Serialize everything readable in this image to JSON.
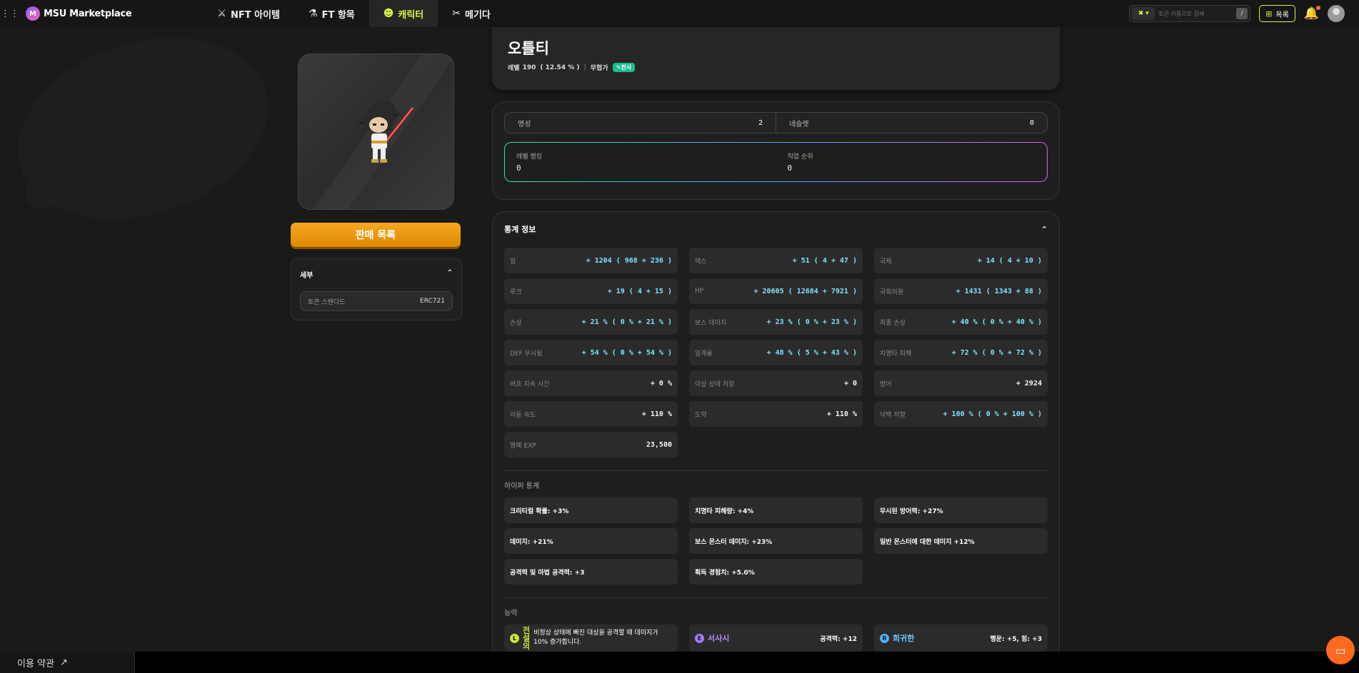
{
  "header": {
    "logo_text": "MSU Marketplace",
    "nav": [
      {
        "label": "NFT 아이템",
        "icon": "swords-icon"
      },
      {
        "label": "FT 항목",
        "icon": "potion-icon"
      },
      {
        "label": "캐릭터",
        "icon": "character-icon",
        "active": true
      },
      {
        "label": "메기다",
        "icon": "tools-icon"
      }
    ],
    "search_placeholder": "토큰 이름으로 검색",
    "search_shortcut": "/",
    "list_button": "목록"
  },
  "footer": {
    "terms": "이용 약관"
  },
  "left": {
    "sell_button": "판매 목록",
    "detail_title": "세부",
    "detail_rows": [
      {
        "key": "토큰 스탠다드",
        "value": "ERC721"
      }
    ]
  },
  "character": {
    "name": "오틀티",
    "level_label": "레벨",
    "level": "190",
    "level_pct": "( 12.54 % )",
    "job": "무협가",
    "job_badge": "전사"
  },
  "fame": [
    {
      "key": "명성",
      "value": "2"
    },
    {
      "key": "네슬렛",
      "value": "0"
    }
  ],
  "ranking": [
    {
      "key": "레벨 랭킹",
      "value": "0"
    },
    {
      "key": "직업 순위",
      "value": "0"
    }
  ],
  "stats": {
    "title": "통계 정보",
    "items": [
      {
        "key": "힘",
        "value": "+ 1204 ( 968 + 236 )",
        "accent": true
      },
      {
        "key": "덱스",
        "value": "+ 51 ( 4 + 47 )",
        "accent": true
      },
      {
        "key": "국제",
        "value": "+ 14 ( 4 + 10 )",
        "accent": true
      },
      {
        "key": "루크",
        "value": "+ 19 ( 4 + 15 )",
        "accent": true
      },
      {
        "key": "HP",
        "value": "+ 20605 ( 12684 + 7921 )",
        "accent": true
      },
      {
        "key": "국회의원",
        "value": "+ 1431 ( 1343 + 88 )",
        "accent": true
      },
      {
        "key": "손상",
        "value": "+ 21 % ( 0 % + 21 % )",
        "accent": true
      },
      {
        "key": "보스 데미지",
        "value": "+ 23 % ( 0 % + 23 % )",
        "accent": true
      },
      {
        "key": "최종 손상",
        "value": "+ 40 % ( 0 % + 40 % )",
        "accent": true
      },
      {
        "key": "DEF 무시됨",
        "value": "+ 54 % ( 0 % + 54 % )",
        "accent": true
      },
      {
        "key": "임계율",
        "value": "+ 48 % ( 5 % + 43 % )",
        "accent": true
      },
      {
        "key": "치명타 피해",
        "value": "+ 72 % ( 0 % + 72 % )",
        "accent": true
      },
      {
        "key": "버프 지속 시간",
        "value": "+ 0 %",
        "accent": false
      },
      {
        "key": "이상 상태 저항",
        "value": "+ 0",
        "accent": false
      },
      {
        "key": "방어",
        "value": "+ 2924",
        "accent": false
      },
      {
        "key": "이동 속도",
        "value": "+ 110 %",
        "accent": false
      },
      {
        "key": "도약",
        "value": "+ 110 %",
        "accent": false
      },
      {
        "key": "넉백 저항",
        "value": "+ 100 % ( 0 % + 100 % )",
        "accent": true
      },
      {
        "key": "명예 EXP",
        "value": "23,500",
        "accent": false
      }
    ]
  },
  "hyper": {
    "title": "하이퍼 통계",
    "items": [
      "크리티컬 확률: +3%",
      "치명타 피해량: +4%",
      "무시된 방어력: +27%",
      "데미지: +21%",
      "보스 몬스터 데미지: +23%",
      "일반 몬스터에 대한 데미지 +12%",
      "공격력 및 마법 공격력: +3",
      "획득 경험치: +5.0%"
    ]
  },
  "ability": {
    "title": "능력",
    "items": [
      {
        "grade": "L",
        "name": "전설의",
        "desc": "비정상 상태에 빠진 대상을 공격할 때 데미지가 10% 증가합니다.",
        "value": ""
      },
      {
        "grade": "E",
        "name": "서사시",
        "desc": "",
        "value": "공격력: +12"
      },
      {
        "grade": "R",
        "name": "희귀한",
        "desc": "",
        "value": "행운: +5, 힘: +3"
      }
    ]
  },
  "colors": {
    "accent": "#d6f34a",
    "stat_value": "#7fe3ff",
    "sell": "#f5a623",
    "badge": "#1fb98f"
  }
}
